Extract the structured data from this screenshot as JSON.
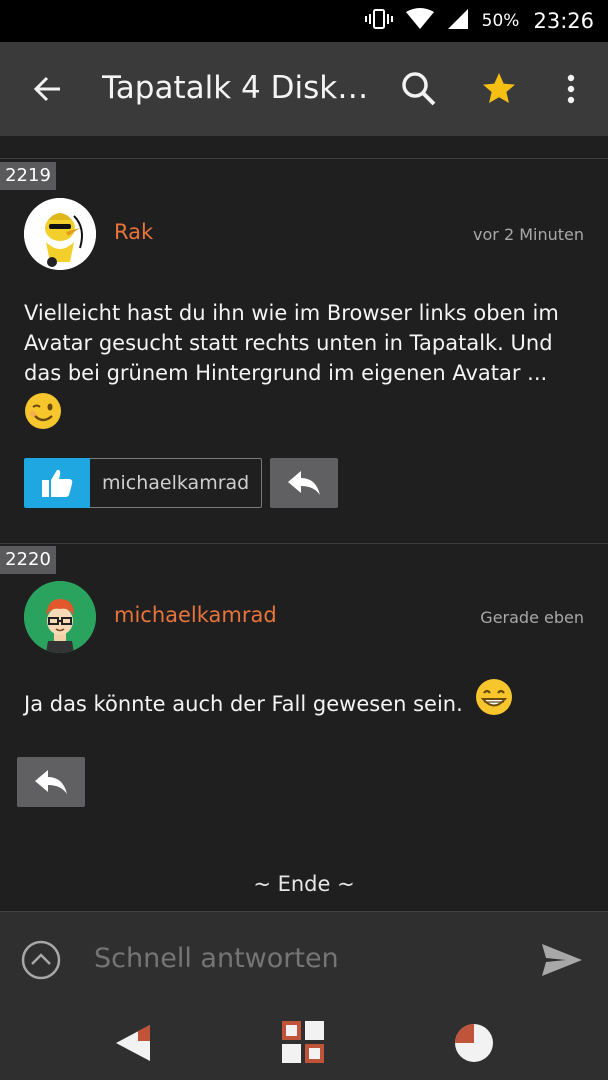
{
  "status_bar": {
    "battery": "50%",
    "time": "23:26",
    "icons": [
      "vibrate-icon",
      "wifi-icon",
      "cell-signal-icon"
    ]
  },
  "toolbar": {
    "title": "Tapatalk 4 Disk…",
    "back_icon": "arrow-back-icon",
    "search_icon": "search-icon",
    "favorite_icon": "star-icon",
    "menu_icon": "more-vert-icon",
    "star_color": "#f5c013"
  },
  "posts": [
    {
      "number": "2219",
      "author": "Rak",
      "time": "vor 2 Minuten",
      "text": "Vielleicht hast du ihn wie im Browser links oben im Avatar gesucht statt rechts unten in Tapatalk. Und das bei grünem Hintergrund im eigenen Avatar ...",
      "emoji": "winking-face-emoji",
      "likes": [
        "michaelkamrad"
      ]
    },
    {
      "number": "2220",
      "author": "michaelkamrad",
      "time": "Gerade eben",
      "text": "Ja das könnte auch der Fall gewesen sein.",
      "emoji": "grinning-face-emoji"
    }
  ],
  "end_marker": "~ Ende ~",
  "composer": {
    "placeholder": "Schnell antworten",
    "expand_icon": "chevron-up-icon",
    "send_icon": "send-icon"
  },
  "bottom_nav": {
    "icons": [
      "back-nav-icon",
      "home-nav-icon",
      "recents-nav-icon"
    ]
  },
  "colors": {
    "background": "#1f1f20",
    "toolbar": "#3a3a3b",
    "username": "#e8743b",
    "like_button": "#1ea7e1",
    "reply_button": "#606062"
  }
}
